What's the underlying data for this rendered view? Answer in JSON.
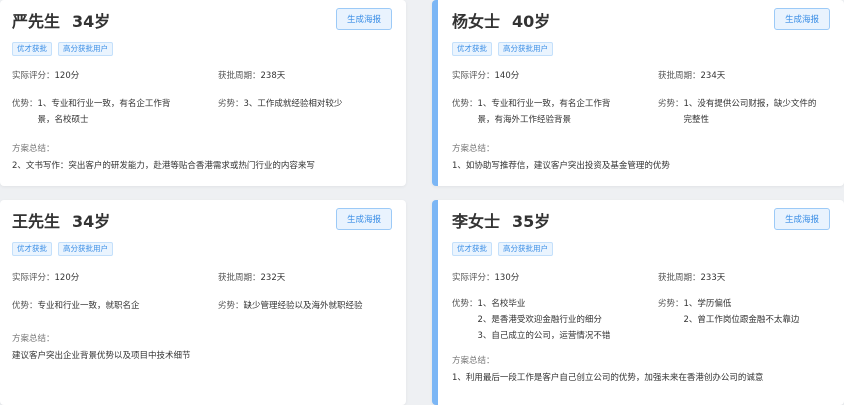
{
  "poster_label": "生成海报",
  "labels": {
    "score": "实际评分：",
    "period": "获批周期：",
    "strength": "优势：",
    "weakness": "劣势：",
    "summary": "方案总结："
  },
  "cards": [
    {
      "name": "严先生",
      "age": "34岁",
      "tags": [
        "优才获批",
        "高分获批用户"
      ],
      "score": "120分",
      "period": "238天",
      "strengths": [
        "1、专业和行业一致，有名企工作背",
        "景，名校硕士"
      ],
      "weaknesses": [
        "3、工作成就经验相对较少"
      ],
      "summary": "2、文书写作：突出客户的研发能力，赴港等贴合香港需求或热门行业的内容来写"
    },
    {
      "name": "杨女士",
      "age": "40岁",
      "tags": [
        "优才获批",
        "高分获批用户"
      ],
      "score": "140分",
      "period": "234天",
      "strengths": [
        "1、专业和行业一致，有名企工作背",
        "景，有海外工作经验背景"
      ],
      "weaknesses": [
        "1、没有提供公司财报，缺少文件的",
        "完整性"
      ],
      "summary": "1、如协助写推荐信，建议客户突出投资及基金管理的优势"
    },
    {
      "name": "王先生",
      "age": "34岁",
      "tags": [
        "优才获批",
        "高分获批用户"
      ],
      "score": "120分",
      "period": "232天",
      "strengths": [
        "专业和行业一致，就职名企"
      ],
      "weaknesses": [
        "缺少管理经验以及海外就职经验"
      ],
      "summary": "建议客户突出企业背景优势以及项目中技术细节"
    },
    {
      "name": "李女士",
      "age": "35岁",
      "tags": [
        "优才获批",
        "高分获批用户"
      ],
      "score": "130分",
      "period": "233天",
      "strengths": [
        "1、名校毕业",
        "2、是香港受欢迎金融行业的细分",
        "3、自己成立的公司，运营情况不错"
      ],
      "weaknesses": [
        "1、学历偏低",
        "2、曾工作岗位跟金融不太靠边"
      ],
      "summary": "1、利用最后一段工作是客户自己创立公司的优势，加强未来在香港创办公司的诚意"
    }
  ]
}
